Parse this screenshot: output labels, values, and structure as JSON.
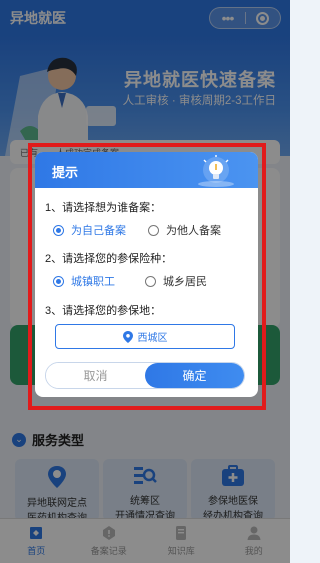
{
  "navbar": {
    "title": "异地就医",
    "more_glyph": "•••",
    "close_icon": "target-icon"
  },
  "banner": {
    "title": "异地就医快速备案",
    "subtitle": "人工审核 · 审核周期2-3工作日"
  },
  "background": {
    "notice": "已有……人成功完成备案",
    "section_title": "服务类型",
    "services": [
      {
        "line1": "异地联网定点",
        "line2": "医药机构查询",
        "icon": "location-person-icon"
      },
      {
        "line1": "统筹区",
        "line2": "开通情况查询",
        "icon": "search-list-icon"
      },
      {
        "line1": "参保地医保",
        "line2": "经办机构查询",
        "icon": "medical-box-icon"
      }
    ]
  },
  "tabbar": {
    "tabs": [
      {
        "label": "首页",
        "icon": "home-icon",
        "active": true
      },
      {
        "label": "备案记录",
        "icon": "record-icon",
        "active": false
      },
      {
        "label": "知识库",
        "icon": "book-icon",
        "active": false
      },
      {
        "label": "我的",
        "icon": "user-icon",
        "active": false
      }
    ]
  },
  "dialog": {
    "title": "提示",
    "q1": {
      "label": "1、请选择想为谁备案：",
      "options": [
        "为自己备案",
        "为他人备案"
      ],
      "selected": 0
    },
    "q2": {
      "label": "2、请选择您的参保险种：",
      "options": [
        "城镇职工",
        "城乡居民"
      ],
      "selected": 0
    },
    "q3": {
      "label": "3、请选择您的参保地：",
      "value": "西城区"
    },
    "cancel_label": "取消",
    "confirm_label": "确定"
  },
  "colors": {
    "primary": "#2f78e6",
    "highlight_frame": "#e11b1b"
  }
}
